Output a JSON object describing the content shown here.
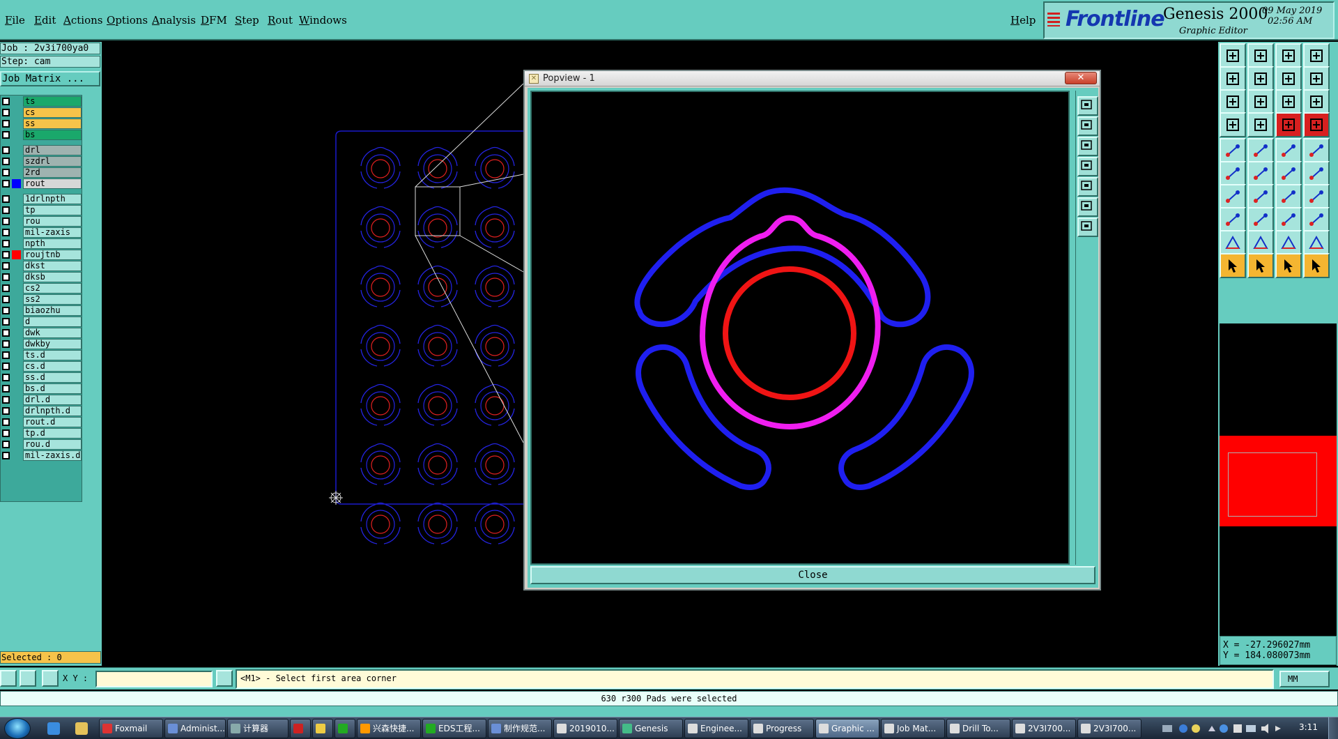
{
  "menu": [
    "File",
    "Edit",
    "Actions",
    "Options",
    "Analysis",
    "DFM",
    "Step",
    "Rout",
    "Windows"
  ],
  "help_label": "Help",
  "brand": {
    "logo": "Frontline",
    "product": "Genesis 2000",
    "subtitle": "Graphic Editor",
    "date": "09 May 2019",
    "time": "02:56 AM"
  },
  "job": {
    "job_line": "Job : 2v3i700ya0",
    "step_line": "Step: cam",
    "matrix_button": "Job Matrix ..."
  },
  "layers": [
    {
      "name": "ts",
      "color": "#1aa86b",
      "swatch": ""
    },
    {
      "name": "cs",
      "color": "#f6c34a",
      "swatch": ""
    },
    {
      "name": "ss",
      "color": "#f6c34a",
      "swatch": ""
    },
    {
      "name": "bs",
      "color": "#1aa86b",
      "swatch": ""
    },
    {
      "name": "drl",
      "color": "#9fb3b0",
      "swatch": ""
    },
    {
      "name": "szdrl",
      "color": "#9fb3b0",
      "swatch": ""
    },
    {
      "name": "2rd",
      "color": "#9fb3b0",
      "swatch": ""
    },
    {
      "name": "rout",
      "color": "#d7d7d7",
      "swatch": "#0000ff"
    },
    {
      "name": "1drlnpth",
      "color": "#a6e4dc",
      "swatch": ""
    },
    {
      "name": "tp",
      "color": "#a6e4dc",
      "swatch": ""
    },
    {
      "name": "rou",
      "color": "#a6e4dc",
      "swatch": ""
    },
    {
      "name": "mil-zaxis",
      "color": "#a6e4dc",
      "swatch": ""
    },
    {
      "name": "npth",
      "color": "#a6e4dc",
      "swatch": ""
    },
    {
      "name": "roujtnb",
      "color": "#a6e4dc",
      "swatch": "#ff0000"
    },
    {
      "name": "dkst",
      "color": "#a6e4dc",
      "swatch": ""
    },
    {
      "name": "dksb",
      "color": "#a6e4dc",
      "swatch": ""
    },
    {
      "name": "cs2",
      "color": "#a6e4dc",
      "swatch": ""
    },
    {
      "name": "ss2",
      "color": "#a6e4dc",
      "swatch": ""
    },
    {
      "name": "biaozhu",
      "color": "#a6e4dc",
      "swatch": ""
    },
    {
      "name": "d",
      "color": "#a6e4dc",
      "swatch": ""
    },
    {
      "name": "dwk",
      "color": "#a6e4dc",
      "swatch": ""
    },
    {
      "name": "dwkby",
      "color": "#a6e4dc",
      "swatch": ""
    },
    {
      "name": "ts.d",
      "color": "#a6e4dc",
      "swatch": ""
    },
    {
      "name": "cs.d",
      "color": "#a6e4dc",
      "swatch": ""
    },
    {
      "name": "ss.d",
      "color": "#a6e4dc",
      "swatch": ""
    },
    {
      "name": "bs.d",
      "color": "#a6e4dc",
      "swatch": ""
    },
    {
      "name": "drl.d",
      "color": "#a6e4dc",
      "swatch": ""
    },
    {
      "name": "drlnpth.d",
      "color": "#a6e4dc",
      "swatch": ""
    },
    {
      "name": "rout.d",
      "color": "#a6e4dc",
      "swatch": ""
    },
    {
      "name": "tp.d",
      "color": "#a6e4dc",
      "swatch": ""
    },
    {
      "name": "rou.d",
      "color": "#a6e4dc",
      "swatch": ""
    },
    {
      "name": "mil-zaxis.d",
      "color": "#a6e4dc",
      "swatch": ""
    }
  ],
  "selected_label": "Selected : 0",
  "popview": {
    "title": "Popview - 1",
    "close_button": "Close",
    "tool_icons": [
      "fit-icon",
      "zoom-home-icon",
      "zoom-back-icon",
      "zoom-prev-icon",
      "zoom-next-icon",
      "zoom-in-icon",
      "zoom-out-icon"
    ]
  },
  "pcb": {
    "grid_rows": 7,
    "grid_cols": 3,
    "colors": {
      "outline": "#2424e0",
      "drill": "#e02020",
      "profile": "#1a1acc"
    }
  },
  "popview_pad": {
    "colors": {
      "rout": "#1f1ff0",
      "pad": "#f01ef0",
      "drill": "#f01414"
    }
  },
  "right_tools": [
    "snap-up-icon",
    "snap-down-icon",
    "home-icon",
    "window-icon",
    "pan-left-icon",
    "pan-right-icon",
    "sheet-icon",
    "curve-icon",
    "fit-screen-icon",
    "fit-vertical-icon",
    "scale-1to2-icon",
    "question-icon",
    "layers-icon",
    "measure-icon",
    "split-red-icon",
    "split-red2-icon",
    "feature-add-icon",
    "feature-line-icon",
    "ruler-icon",
    "circle-icon",
    "net-icon",
    "cross-icon",
    "nodes-icon",
    "nodes2-icon",
    "angle-icon",
    "slope-icon",
    "arc-icon",
    "arrow-f-icon",
    "box-icon",
    "line-icon",
    "move-icon",
    "copy-icon",
    "triangle-icon",
    "triangle-blue-icon",
    "triangle-a-icon",
    "triangle-a2-icon",
    "pointer-icon",
    "pointer-box-icon",
    "pointer-circle-icon",
    "pointer-path-icon"
  ],
  "coords": {
    "x_line": "X = -27.296027mm",
    "y_line": "Y = 184.080073mm"
  },
  "command": {
    "xy_label": "X Y :",
    "xy_value": "",
    "prompt": "<M1> - Select first area corner",
    "units": "MM"
  },
  "status_message": "630 r300 Pads were selected",
  "taskbar": {
    "items": [
      {
        "label": "Foxmail",
        "icon_color": "#d33"
      },
      {
        "label": "Administ...",
        "icon_color": "#6a8fd6"
      },
      {
        "label": "计算器",
        "icon_color": "#8aa"
      },
      {
        "label": "",
        "icon_color": "#c22"
      },
      {
        "label": "",
        "icon_color": "#ec4"
      },
      {
        "label": "",
        "icon_color": "#2a2"
      },
      {
        "label": "兴森快捷...",
        "icon_color": "#f90"
      },
      {
        "label": "EDS工程...",
        "icon_color": "#2a2"
      },
      {
        "label": "制作规范...",
        "icon_color": "#6a8fd6"
      },
      {
        "label": "2019010...",
        "icon_color": "#ddd"
      },
      {
        "label": "Genesis",
        "icon_color": "#4b8"
      },
      {
        "label": "Enginee...",
        "icon_color": "#ddd"
      },
      {
        "label": "Progress",
        "icon_color": "#ddd"
      },
      {
        "label": "Graphic ...",
        "icon_color": "#ddd"
      },
      {
        "label": "Job Mat...",
        "icon_color": "#ddd"
      },
      {
        "label": "Drill To...",
        "icon_color": "#ddd"
      },
      {
        "label": "2V3I700...",
        "icon_color": "#ddd"
      },
      {
        "label": "2V3I700...",
        "icon_color": "#ddd"
      }
    ],
    "clock": "3:11"
  }
}
